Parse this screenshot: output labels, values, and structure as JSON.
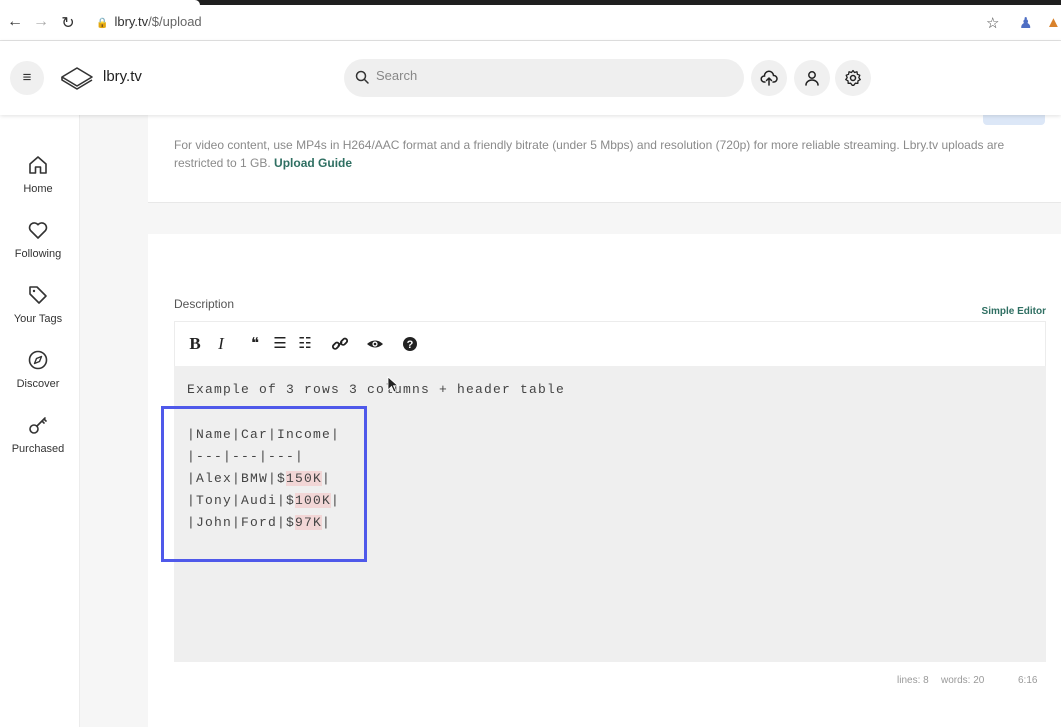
{
  "browser": {
    "url_host": "lbry.tv",
    "url_path": "/$/upload"
  },
  "header": {
    "brand": "lbry.tv",
    "search_placeholder": "Search"
  },
  "sidebar": {
    "items": [
      {
        "label": "Home",
        "icon": "home-icon"
      },
      {
        "label": "Following",
        "icon": "heart-icon"
      },
      {
        "label": "Your Tags",
        "icon": "tag-icon"
      },
      {
        "label": "Discover",
        "icon": "compass-icon"
      },
      {
        "label": "Purchased",
        "icon": "key-icon"
      }
    ]
  },
  "upload_info": {
    "text": "For video content, use MP4s in H264/AAC format and a friendly bitrate (under 5 Mbps) and resolution (720p) for more reliable streaming. Lbry.tv uploads are restricted to 1 GB.",
    "guide_link": "Upload Guide"
  },
  "description": {
    "label": "Description",
    "simple_editor": "Simple Editor",
    "toolbar": {
      "bold": "B",
      "italic": "I",
      "quote": "❝",
      "bullets": "☰",
      "numbered": "☷",
      "link": "🔗",
      "preview": "👁",
      "help": "?"
    },
    "editor_lines": {
      "l1": "Example of 3 rows 3 columns + header table",
      "l2": "|Name|Car|Income|",
      "l3": "|---|---|---|",
      "l4a": "|Alex|BMW|$",
      "l4b": "150K",
      "l4c": "|",
      "l5a": "|Tony|Audi|$",
      "l5b": "100K",
      "l5c": "|",
      "l6a": "|John|Ford|$",
      "l6b": "97K",
      "l6c": "|"
    },
    "status": {
      "lines": "lines: 8",
      "words": "words: 20",
      "cursor": "6:16"
    }
  },
  "colors": {
    "accent_green": "#2f6f62",
    "highlight_box": "#4f59ea"
  }
}
